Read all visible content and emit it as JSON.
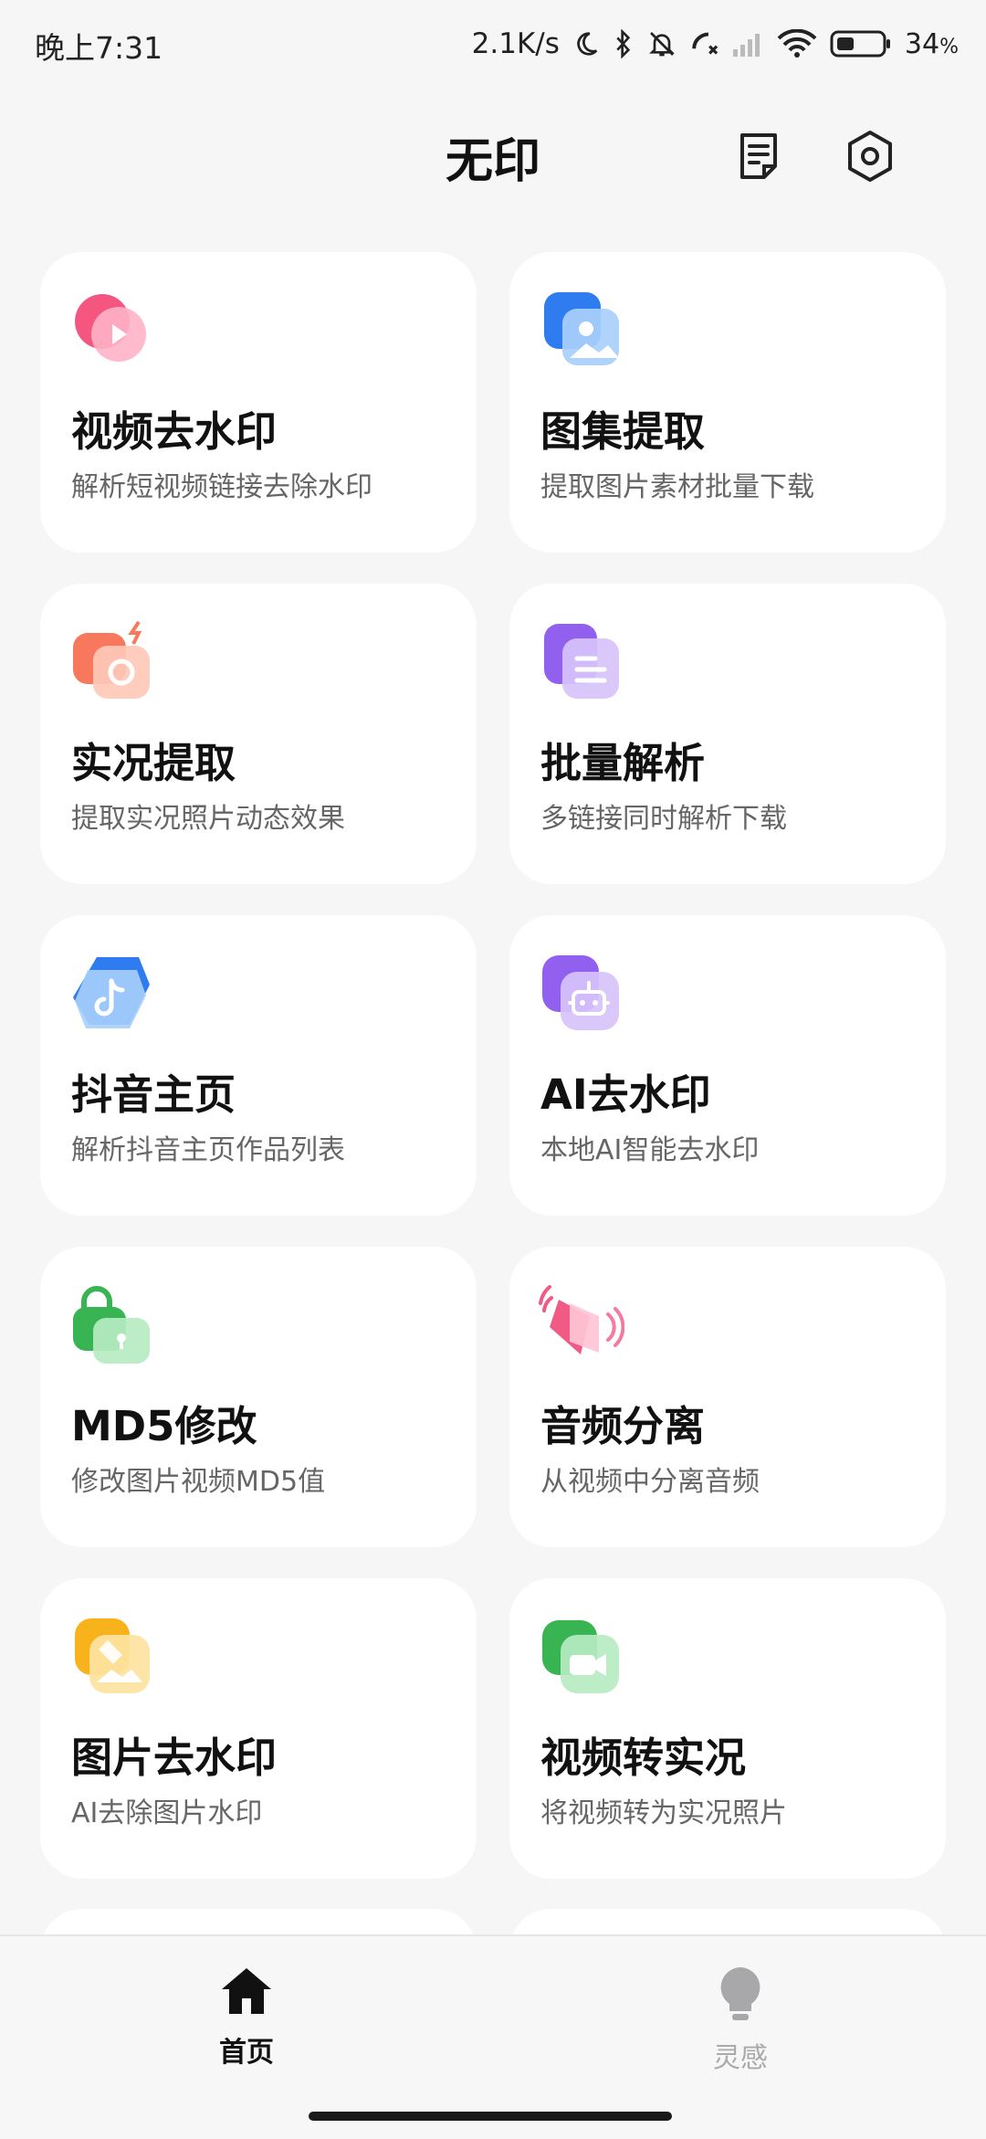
{
  "status_bar": {
    "time": "晚上7:31",
    "net_speed": "2.1K/s",
    "battery_pct": "34",
    "battery_unit": "%",
    "icons": [
      "moon-icon",
      "bluetooth-icon",
      "mute-bell-icon",
      "call-missed-icon",
      "cell-signal-icon",
      "wifi-icon",
      "battery-icon"
    ]
  },
  "header": {
    "title": "无印",
    "icons": [
      "document-icon",
      "settings-icon"
    ]
  },
  "features": [
    {
      "title": "视频去水印",
      "subtitle": "解析短视频链接去除水印",
      "icon": "video-play-icon",
      "color": "#f25a86"
    },
    {
      "title": "图集提取",
      "subtitle": "提取图片素材批量下载",
      "icon": "image-gallery-icon",
      "color": "#3d8ef5"
    },
    {
      "title": "实况提取",
      "subtitle": "提取实况照片动态效果",
      "icon": "live-photo-camera-icon",
      "color": "#f98062"
    },
    {
      "title": "批量解析",
      "subtitle": "多链接同时解析下载",
      "icon": "document-list-icon",
      "color": "#9a6cf0"
    },
    {
      "title": "抖音主页",
      "subtitle": "解析抖音主页作品列表",
      "icon": "tiktok-icon",
      "color": "#3d8ef5"
    },
    {
      "title": "AI去水印",
      "subtitle": "本地AI智能去水印",
      "icon": "robot-icon",
      "color": "#9a6cf0"
    },
    {
      "title": "MD5修改",
      "subtitle": "修改图片视频MD5值",
      "icon": "lock-icon",
      "color": "#3dbb5c"
    },
    {
      "title": "音频分离",
      "subtitle": "从视频中分离音频",
      "icon": "speaker-icon",
      "color": "#f57aa0"
    },
    {
      "title": "图片去水印",
      "subtitle": "AI去除图片水印",
      "icon": "image-eraser-icon",
      "color": "#f9b82c"
    },
    {
      "title": "视频转实况",
      "subtitle": "将视频转为实况照片",
      "icon": "video-camera-icon",
      "color": "#3dbb5c"
    }
  ],
  "bottom_nav": [
    {
      "label": "首页",
      "icon": "home-icon",
      "active": true
    },
    {
      "label": "灵感",
      "icon": "lightbulb-icon",
      "active": false
    }
  ]
}
